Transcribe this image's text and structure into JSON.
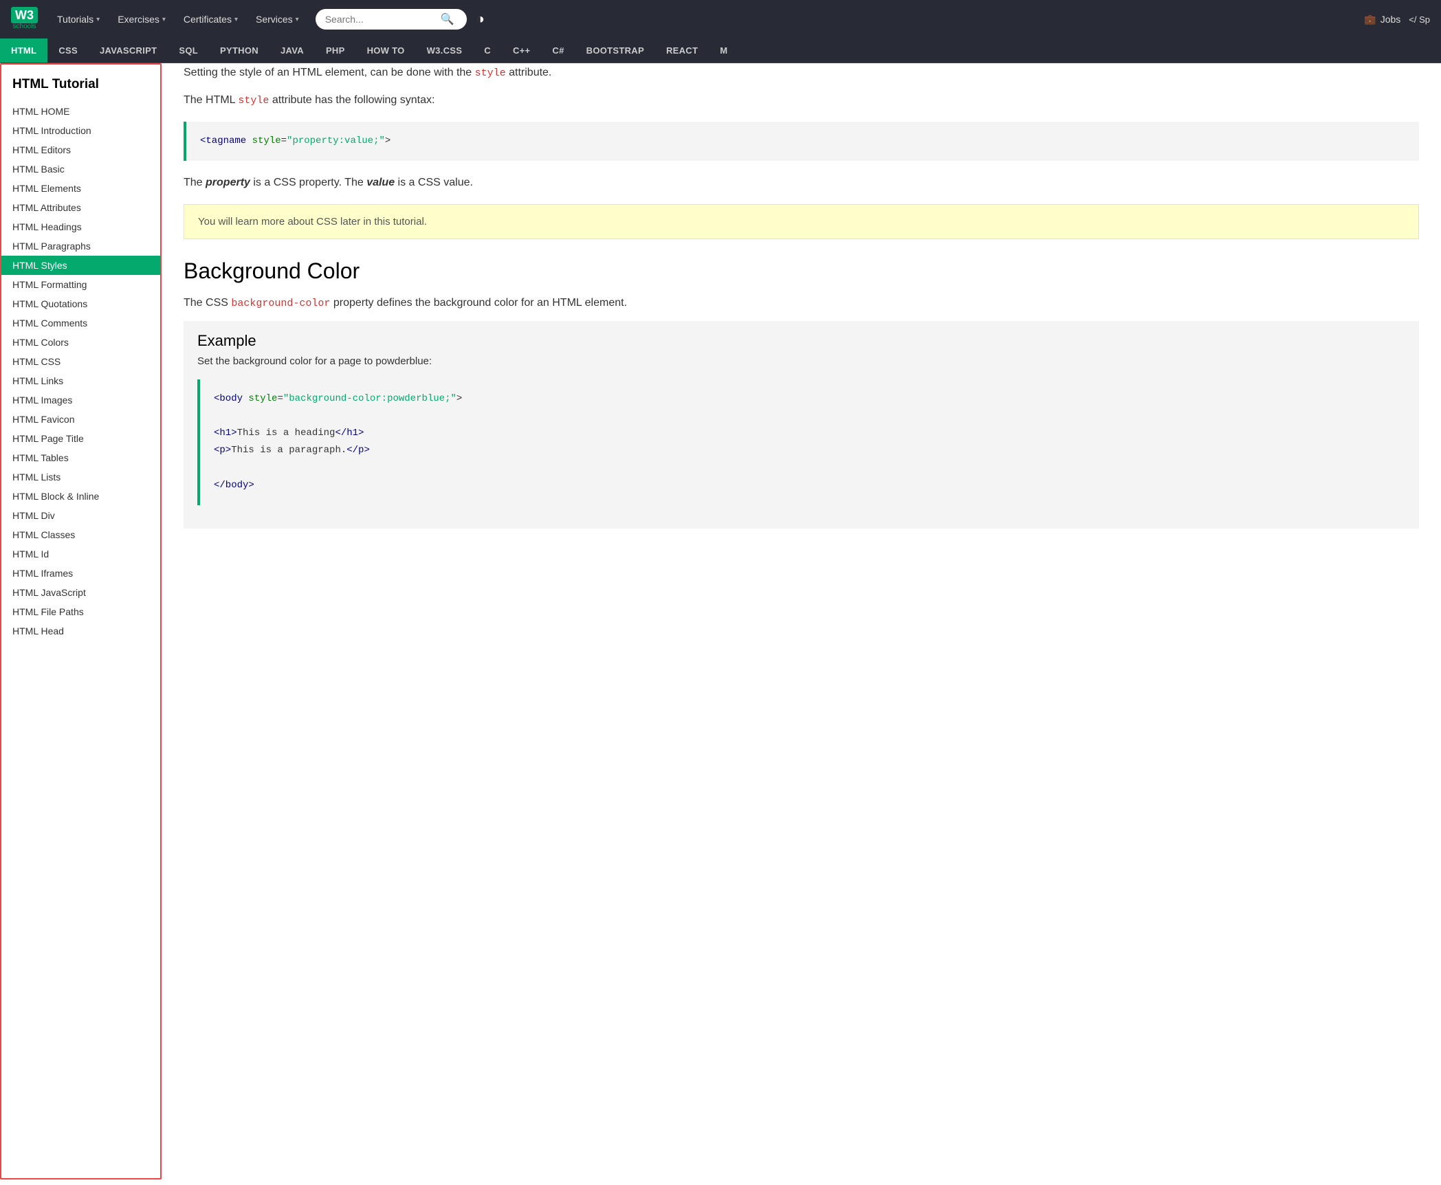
{
  "nav": {
    "logo_text": "W3",
    "logo_sub": "schools",
    "items": [
      {
        "label": "Tutorials",
        "has_arrow": true
      },
      {
        "label": "Exercises",
        "has_arrow": true
      },
      {
        "label": "Certificates",
        "has_arrow": true
      },
      {
        "label": "Services",
        "has_arrow": true
      }
    ],
    "search_placeholder": "Search...",
    "jobs_label": "Jobs",
    "code_label": "</ Sp"
  },
  "topic_bar": {
    "items": [
      {
        "label": "HTML",
        "active": true
      },
      {
        "label": "CSS"
      },
      {
        "label": "JAVASCRIPT"
      },
      {
        "label": "SQL"
      },
      {
        "label": "PYTHON"
      },
      {
        "label": "JAVA"
      },
      {
        "label": "PHP"
      },
      {
        "label": "HOW TO"
      },
      {
        "label": "W3.CSS"
      },
      {
        "label": "C"
      },
      {
        "label": "C++"
      },
      {
        "label": "C#"
      },
      {
        "label": "BOOTSTRAP"
      },
      {
        "label": "REACT"
      },
      {
        "label": "M"
      }
    ]
  },
  "sidebar": {
    "title": "HTML Tutorial",
    "items": [
      {
        "label": "HTML HOME"
      },
      {
        "label": "HTML Introduction"
      },
      {
        "label": "HTML Editors"
      },
      {
        "label": "HTML Basic"
      },
      {
        "label": "HTML Elements"
      },
      {
        "label": "HTML Attributes"
      },
      {
        "label": "HTML Headings"
      },
      {
        "label": "HTML Paragraphs"
      },
      {
        "label": "HTML Styles",
        "active": true
      },
      {
        "label": "HTML Formatting"
      },
      {
        "label": "HTML Quotations"
      },
      {
        "label": "HTML Comments"
      },
      {
        "label": "HTML Colors"
      },
      {
        "label": "HTML CSS"
      },
      {
        "label": "HTML Links"
      },
      {
        "label": "HTML Images"
      },
      {
        "label": "HTML Favicon"
      },
      {
        "label": "HTML Page Title"
      },
      {
        "label": "HTML Tables"
      },
      {
        "label": "HTML Lists"
      },
      {
        "label": "HTML Block & Inline"
      },
      {
        "label": "HTML Div"
      },
      {
        "label": "HTML Classes"
      },
      {
        "label": "HTML Id"
      },
      {
        "label": "HTML Iframes"
      },
      {
        "label": "HTML JavaScript"
      },
      {
        "label": "HTML File Paths"
      },
      {
        "label": "HTML Head"
      }
    ]
  },
  "content": {
    "intro_line1": "Setting the style of an HTML element, can be done with the ",
    "intro_style_code": "style",
    "intro_line1_end": " attribute.",
    "intro_line2": "The HTML ",
    "intro_style_code2": "style",
    "intro_line2_end": " attribute has the following syntax:",
    "code_example_1": "<tagname style=\"property:value;\">",
    "property_text_1": "The ",
    "property_bold": "property",
    "property_text_2": " is a CSS property. The ",
    "value_bold": "value",
    "property_text_3": " is a CSS value.",
    "note_text": "You will learn more about CSS later in this tutorial.",
    "bg_color_title": "Background Color",
    "bg_color_text_1": "The CSS ",
    "bg_color_code": "background-color",
    "bg_color_text_2": " property defines the background color for an HTML element.",
    "example_title": "Example",
    "example_subtitle": "Set the background color for a page to powderblue:",
    "code_example_2_line1": "<body style=\"background-color:powderblue;\">",
    "code_example_2_line2": "",
    "code_example_2_line3": "<h1>This is a heading</h1>",
    "code_example_2_line4": "<p>This is a paragraph.</p>",
    "code_example_2_line5": "",
    "code_example_2_line6": "</body>"
  },
  "colors": {
    "accent_green": "#04AA6D",
    "nav_bg": "#282A35",
    "sidebar_border": "#e44444",
    "code_red": "#d63333",
    "code_blue": "#000080",
    "code_green2": "#04AA6D"
  }
}
